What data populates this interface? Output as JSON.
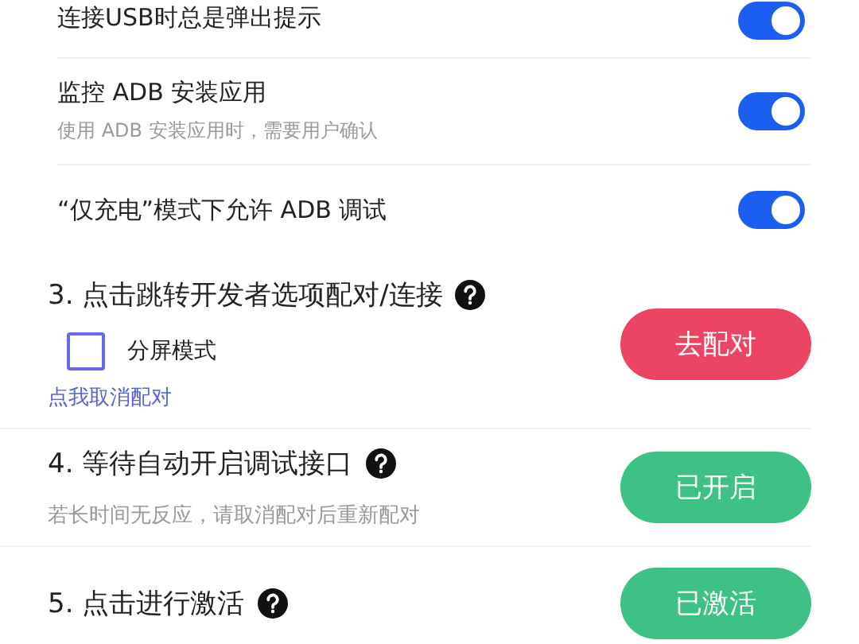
{
  "settings": [
    {
      "title": "连接USB时总是弹出提示",
      "on": true
    },
    {
      "title": "监控 ADB 安装应用",
      "subtitle": "使用 ADB 安装应用时，需要用户确认",
      "on": true
    },
    {
      "title": "“仅充电”模式下允许 ADB 调试",
      "on": true
    }
  ],
  "steps": [
    {
      "title": "3. 点击跳转开发者选项配对/连接",
      "checkbox": {
        "label": "分屏模式",
        "checked": false
      },
      "link": "点我取消配对",
      "button": {
        "label": "去配对",
        "kind": "pending"
      }
    },
    {
      "title": "4. 等待自动开启调试接口",
      "subtitle": "若长时间无反应，请取消配对后重新配对",
      "button": {
        "label": "已开启",
        "kind": "done"
      }
    },
    {
      "title": "5. 点击进行激活",
      "button": {
        "label": "已激活",
        "kind": "done"
      }
    }
  ]
}
